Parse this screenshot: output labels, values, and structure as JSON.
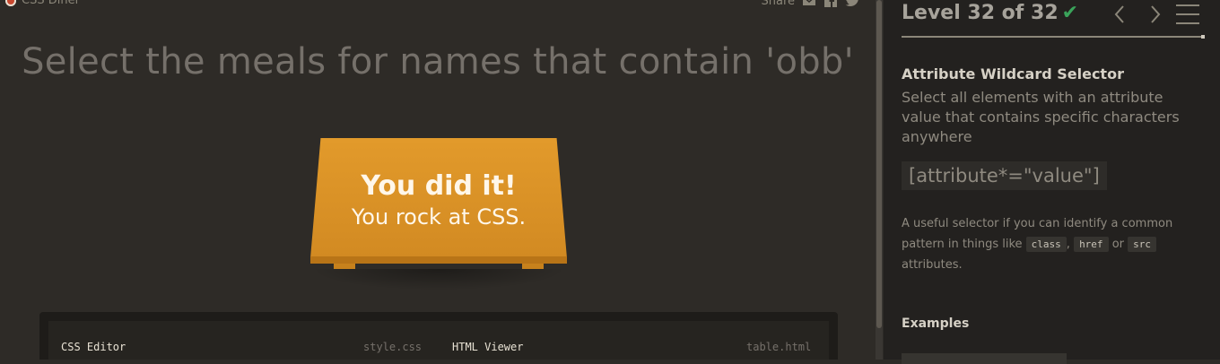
{
  "app": {
    "brand": "CSS Diner"
  },
  "share": {
    "label": "Share",
    "icons": [
      "mail-icon",
      "facebook-icon",
      "twitter-icon"
    ]
  },
  "instruction": "Select the meals for names that contain 'obb'",
  "table": {
    "line1": "You did it!",
    "line2": "You rock at CSS."
  },
  "editor": {
    "css_label": "CSS Editor",
    "css_file": "style.css",
    "html_label": "HTML Viewer",
    "html_file": "table.html"
  },
  "sidebar": {
    "level": "Level 32 of 32",
    "level_complete": true,
    "progress": 1.0,
    "selector_name": "Attribute Wildcard Selector",
    "selector_desc": "Select all elements with an attribute value that contains specific characters anywhere",
    "syntax": "[attribute*=\"value\"]",
    "hint_before": "A useful selector if you can identify a common pattern in things like",
    "hint_codes": [
      "class",
      "href",
      "src"
    ],
    "hint_sep": ",",
    "hint_or": "or",
    "hint_after": "attributes.",
    "examples_title": "Examples"
  },
  "colors": {
    "background": "#2e2b27",
    "sidebar": "#23211f",
    "table": "#e29a2b",
    "check": "#3aa35a"
  }
}
